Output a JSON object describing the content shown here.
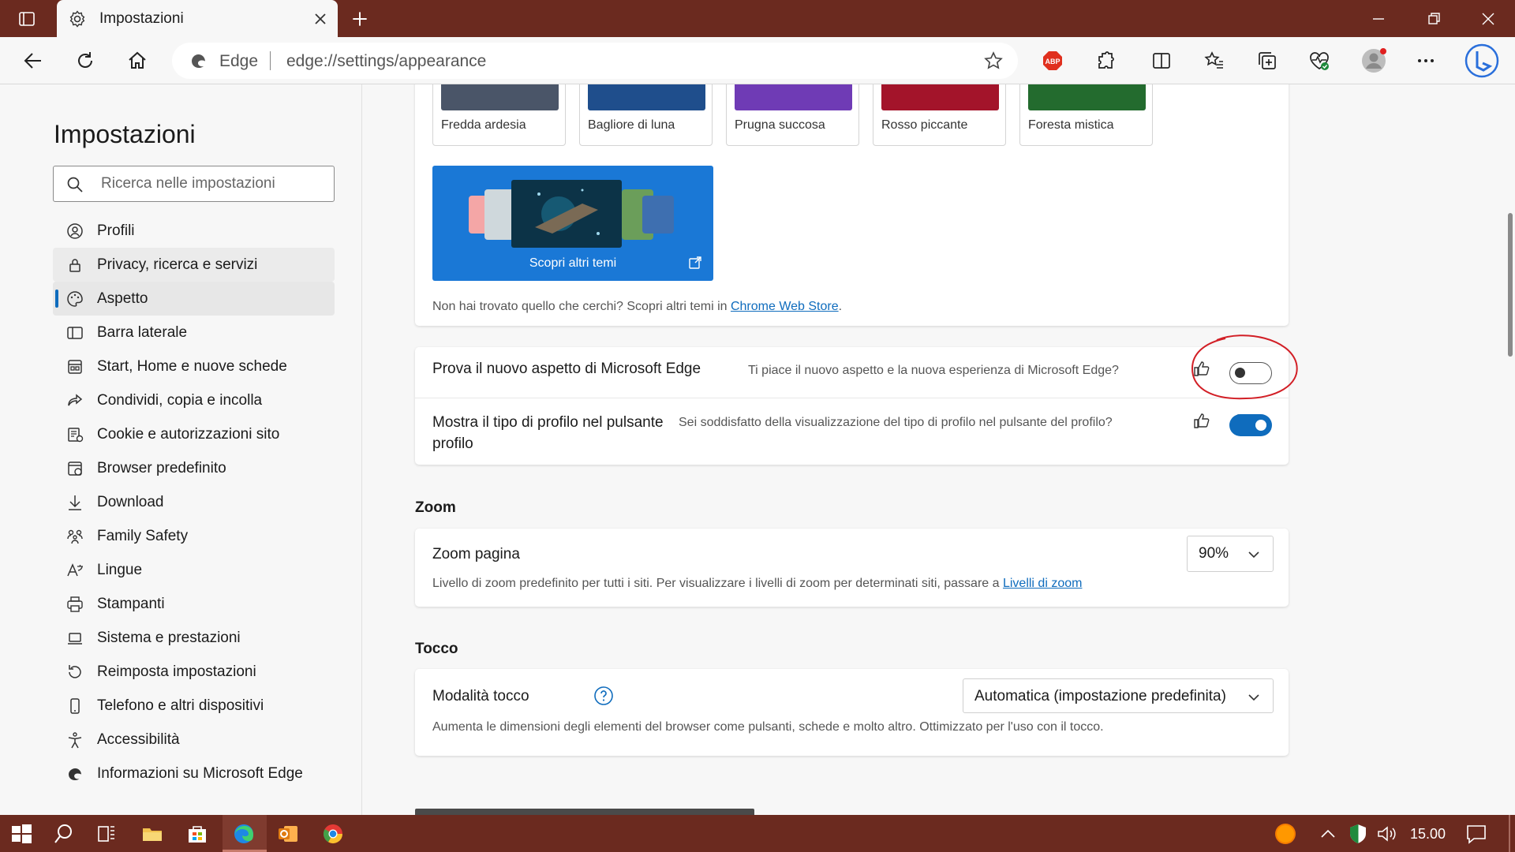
{
  "browser": {
    "tab_title": "Impostazioni",
    "site_name": "Edge",
    "url": "edge://settings/appearance"
  },
  "sidebar": {
    "title": "Impostazioni",
    "search_placeholder": "Ricerca nelle impostazioni",
    "items": [
      {
        "label": "Profili",
        "icon": "profile-icon"
      },
      {
        "label": "Privacy, ricerca e servizi",
        "icon": "lock-icon"
      },
      {
        "label": "Aspetto",
        "icon": "palette-icon"
      },
      {
        "label": "Barra laterale",
        "icon": "sidebar-icon"
      },
      {
        "label": "Start, Home e nuove schede",
        "icon": "newtab-icon"
      },
      {
        "label": "Condividi, copia e incolla",
        "icon": "share-icon"
      },
      {
        "label": "Cookie e autorizzazioni sito",
        "icon": "cookie-icon"
      },
      {
        "label": "Browser predefinito",
        "icon": "browser-icon"
      },
      {
        "label": "Download",
        "icon": "download-icon"
      },
      {
        "label": "Family Safety",
        "icon": "family-icon"
      },
      {
        "label": "Lingue",
        "icon": "language-icon"
      },
      {
        "label": "Stampanti",
        "icon": "printer-icon"
      },
      {
        "label": "Sistema e prestazioni",
        "icon": "laptop-icon"
      },
      {
        "label": "Reimposta impostazioni",
        "icon": "reset-icon"
      },
      {
        "label": "Telefono e altri dispositivi",
        "icon": "phone-icon"
      },
      {
        "label": "Accessibilità",
        "icon": "accessibility-icon"
      },
      {
        "label": "Informazioni su Microsoft Edge",
        "icon": "edge-icon"
      }
    ]
  },
  "themes": {
    "tiles": [
      {
        "name": "Fredda ardesia",
        "color": "#4a5568"
      },
      {
        "name": "Bagliore di luna",
        "color": "#1f4e8c"
      },
      {
        "name": "Prugna succosa",
        "color": "#6f3bb5"
      },
      {
        "name": "Rosso piccante",
        "color": "#a3142a"
      },
      {
        "name": "Foresta mistica",
        "color": "#236b2e"
      }
    ],
    "discover_label": "Scopri altri temi",
    "note_text": "Non hai trovato quello che cerchi? Scopri altri temi in ",
    "note_link": "Chrome Web Store",
    "note_end": "."
  },
  "experiments": {
    "row1": {
      "title": "Prova il nuovo aspetto di Microsoft Edge",
      "question": "Ti piace il nuovo aspetto e la nuova esperienza di Microsoft Edge?",
      "enabled": false
    },
    "row2": {
      "title": "Mostra il tipo di profilo nel pulsante profilo",
      "question": "Sei soddisfatto della visualizzazione del tipo di profilo nel pulsante del profilo?",
      "enabled": true
    }
  },
  "zoom": {
    "section": "Zoom",
    "title": "Zoom pagina",
    "value": "90%",
    "desc": "Livello di zoom predefinito per tutti i siti. Per visualizzare i livelli di zoom per determinati siti, passare a ",
    "link": "Livelli di zoom"
  },
  "touch": {
    "section": "Tocco",
    "title": "Modalità tocco",
    "value": "Automatica (impostazione predefinita)",
    "desc": "Aumenta le dimensioni degli elementi del browser come pulsanti, schede e molto altro. Ottimizzato per l'uso con il tocco."
  },
  "taskbar": {
    "clock": "15.00"
  },
  "colors": {
    "accent": "#0f6cbd",
    "frame": "#6b2a1f",
    "annotation": "#d21f26"
  }
}
